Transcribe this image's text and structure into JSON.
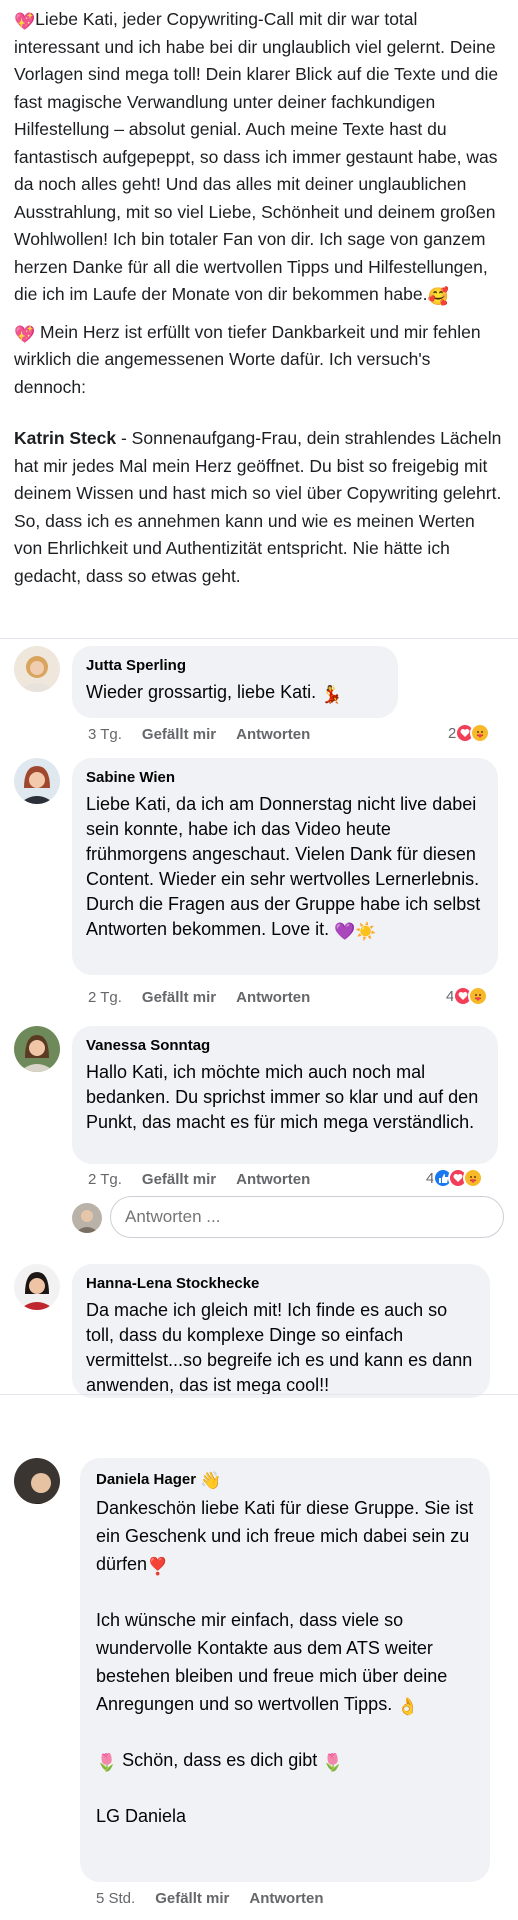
{
  "post": {
    "para1": "Liebe Kati, jeder Copywriting-Call mit dir war total interessant und ich habe bei dir unglaublich viel gelernt. Deine Vorlagen sind mega toll! Dein klarer Blick auf die Texte und die fast magische Verwandlung unter deiner fachkundigen Hilfestellung – absolut genial. Auch meine Texte hast du fantastisch aufgepeppt, so dass ich immer gestaunt habe, was da noch alles geht! Und das alles mit deiner unglaublichen Ausstrahlung, mit so viel Liebe, Schönheit und deinem großen Wohlwollen! Ich bin totaler Fan von dir. Ich sage  von ganzem herzen Danke für all die wertvollen Tipps und Hilfestellungen, die ich im Laufe der Monate von dir bekommen habe.",
    "para2": " Mein Herz ist erfüllt von tiefer Dankbarkeit und mir fehlen wirklich die angemessenen Worte dafür. Ich versuch's dennoch:",
    "testimonial_name": "Katrin Steck",
    "testimonial_text": " - Sonnenaufgang-Frau, dein strahlendes Lächeln hat mir jedes Mal mein Herz geöffnet. Du bist so freigebig mit deinem Wissen und hast mich so viel über Copywriting gelehrt. So, dass ich es annehmen kann und wie es meinen Werten von Ehrlichkeit und Authentizität entspricht. Nie hätte ich gedacht, dass so etwas geht."
  },
  "comments": [
    {
      "name": "Jutta Sperling",
      "text": "Wieder grossartig, liebe Kati.",
      "time": "3 Tg.",
      "like": "Gefällt mir",
      "reply": "Antworten",
      "reactions": "2"
    },
    {
      "name": "Sabine Wien",
      "text": "Liebe Kati, da ich am Donnerstag nicht live dabei sein konnte, habe ich das Video heute frühmorgens angeschaut. Vielen Dank für diesen Content. Wieder ein sehr wertvolles Lernerlebnis. Durch die Fragen aus der Gruppe habe ich selbst Antworten bekommen. Love it.",
      "time": "2 Tg.",
      "like": "Gefällt mir",
      "reply": "Antworten",
      "reactions": "4"
    },
    {
      "name": "Vanessa Sonntag",
      "text": "Hallo Kati, ich möchte mich auch noch mal bedanken. Du sprichst immer so klar und auf den Punkt, das macht es für mich mega verständlich.",
      "time": "2 Tg.",
      "like": "Gefällt mir",
      "reply": "Antworten",
      "reactions": "4"
    },
    {
      "name": "Hanna-Lena Stockhecke",
      "text": "Da mache ich gleich mit! Ich finde es auch so toll, dass du komplexe Dinge so einfach vermittelst...so begreife ich es und kann es dann anwenden, das ist mega cool!!"
    },
    {
      "name": "Daniela Hager",
      "text_a": "Dankeschön liebe Kati für diese Gruppe. Sie ist ein Geschenk und ich freue mich dabei sein zu dürfen",
      "text_b": "Ich wünsche mir einfach, dass viele so wundervolle Kontakte aus dem ATS weiter bestehen bleiben und freue mich über deine Anregungen und so wertvollen Tipps.",
      "text_c": " Schön, dass es dich gibt ",
      "text_d": "LG Daniela",
      "time": "5 Std.",
      "like": "Gefällt mir",
      "reply": "Antworten"
    }
  ],
  "reply_box": {
    "placeholder": "Antworten ..."
  },
  "icons": [
    "sparkling-heart-icon",
    "smiling-face-with-hearts-icon",
    "dancer-icon",
    "purple-heart-icon",
    "sun-icon",
    "waving-hand-icon",
    "heart-exclamation-icon",
    "ok-hand-icon",
    "tulip-icon",
    "love-reaction-icon",
    "care-reaction-icon",
    "like-reaction-icon"
  ],
  "colors": {
    "bubble": "#f0f2f5",
    "meta_text": "#65676b",
    "love": "#f33e58",
    "like": "#1877f2",
    "care": "#f7b928"
  }
}
